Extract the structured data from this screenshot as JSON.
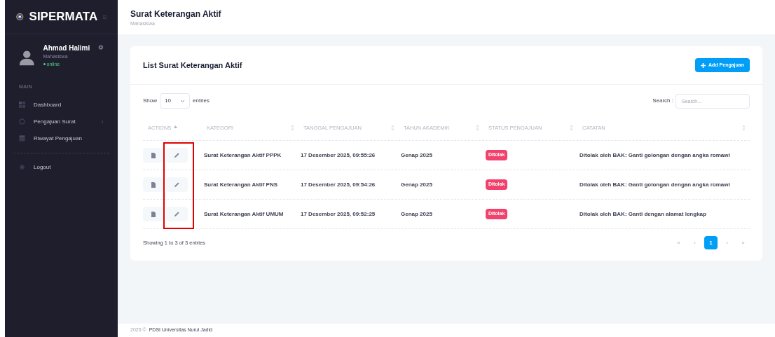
{
  "brand": {
    "title": "SIPERMATA"
  },
  "user": {
    "name": "Ahmad Halimi",
    "role": "Mahasiswa",
    "status": "online"
  },
  "sidebar": {
    "section": "MAIN",
    "items": [
      {
        "label": "Dashboard",
        "kind": "grid",
        "has_submenu": false
      },
      {
        "label": "Pengajuan Surat",
        "kind": "ring",
        "has_submenu": true
      },
      {
        "label": "Riwayat Pengajuan",
        "kind": "calendar",
        "has_submenu": false
      }
    ],
    "footer_items": [
      {
        "label": "Logout",
        "kind": "dot",
        "has_submenu": false
      }
    ]
  },
  "header": {
    "title": "Surat Keterangan Aktif",
    "subtitle": "Mahasiswa"
  },
  "card": {
    "title": "List Surat Keterangan Aktif",
    "add_button": "Add Pengajuan"
  },
  "table": {
    "length_label_before": "Show",
    "length_value": "10",
    "length_label_after": "entries",
    "search_label": "Search :",
    "search_placeholder": "Search...",
    "columns": [
      {
        "label": "ACTIONS",
        "sorted": true
      },
      {
        "label": "KATEGORI",
        "sorted": false
      },
      {
        "label": "TANGGAL PENGAJUAN",
        "sorted": false
      },
      {
        "label": "TAHUN AKADEMIK",
        "sorted": false
      },
      {
        "label": "STATUS PENGAJUAN",
        "sorted": false
      },
      {
        "label": "CATATAN",
        "sorted": false
      }
    ],
    "rows": [
      {
        "kategori": "Surat Keterangan Aktif PPPK",
        "tanggal": "17 Desember 2025, 09:55:26",
        "tahun": "Genap 2025",
        "status": "Ditolak",
        "catatan": "Ditolak oleh BAK: Ganti golongan dengan angka romawi"
      },
      {
        "kategori": "Surat Keterangan Aktif PNS",
        "tanggal": "17 Desember 2025, 09:54:26",
        "tahun": "Genap 2025",
        "status": "Ditolak",
        "catatan": "Ditolak oleh BAK: Ganti golongan dengan angka romawi"
      },
      {
        "kategori": "Surat Keterangan Aktif UMUM",
        "tanggal": "17 Desember 2025, 09:52:25",
        "tahun": "Genap 2025",
        "status": "Ditolak",
        "catatan": "Ditolak oleh BAK: Ganti dengan alamat lengkap"
      }
    ],
    "info": "Showing 1 to 3 of 3 entries",
    "pagination": [
      {
        "label": "«",
        "selected": false
      },
      {
        "label": "‹",
        "selected": false
      },
      {
        "label": "1",
        "selected": true
      },
      {
        "label": "›",
        "selected": false
      },
      {
        "label": "»",
        "selected": false
      }
    ]
  },
  "footer": {
    "year": "2025 ©",
    "org": "PDSI Universitas Nurul Jadid"
  }
}
